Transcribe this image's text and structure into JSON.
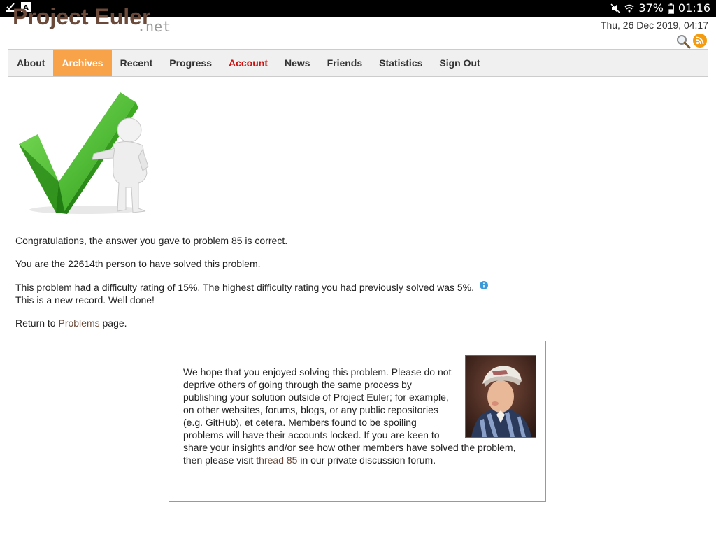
{
  "statusbar": {
    "battery": "37%",
    "time": "01:16"
  },
  "header": {
    "logo_main": "Project Euler",
    "logo_suffix": ".net",
    "datetime": "Thu, 26 Dec 2019, 04:17"
  },
  "nav": {
    "items": [
      {
        "label": "About"
      },
      {
        "label": "Archives"
      },
      {
        "label": "Recent"
      },
      {
        "label": "Progress"
      },
      {
        "label": "Account"
      },
      {
        "label": "News"
      },
      {
        "label": "Friends"
      },
      {
        "label": "Statistics"
      },
      {
        "label": "Sign Out"
      }
    ]
  },
  "content": {
    "congrats": "Congratulations, the answer you gave to problem 85 is correct.",
    "solver_rank": "You are the 22614th person to have solved this problem.",
    "difficulty": "This problem had a difficulty rating of 15%. The highest difficulty rating you had previously solved was 5%.",
    "record": "This is a new record. Well done!",
    "return_prefix": "Return to ",
    "return_link": "Problems",
    "return_suffix": " page."
  },
  "notice": {
    "text_before": "We hope that you enjoyed solving this problem. Please do not deprive others of going through the same process by publishing your solution outside of Project Euler; for example, on other websites, forums, blogs, or any public repositories (e.g. GitHub), et cetera. Members found to be spoiling problems will have their accounts locked. If you are keen to share your insights and/or see how other members have solved the problem, then please visit ",
    "thread_link": "thread 85",
    "text_after": " in our private discussion forum."
  },
  "colors": {
    "accent_orange": "#f8a34a",
    "account_red": "#cc1111",
    "link_brown": "#6b4a3a"
  }
}
